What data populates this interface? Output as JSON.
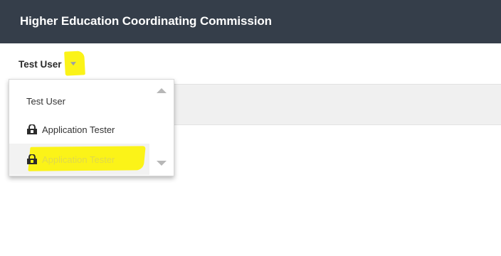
{
  "header": {
    "title": "Higher Education Coordinating Commission"
  },
  "user_menu": {
    "current_user": "Test User",
    "caret_icon": "chevron-down-icon",
    "highlight_color": "#fbf318",
    "items": [
      {
        "label": "Test User",
        "icon": null
      },
      {
        "label": "Application Tester",
        "icon": "lock-badge-icon"
      },
      {
        "label": "Application Tester",
        "icon": "lock-badge-icon",
        "state": "hovered"
      }
    ]
  },
  "scrollbar": {
    "up_icon": "triangle-up-icon",
    "down_icon": "triangle-down-icon"
  },
  "colors": {
    "header_bg": "#353e4a",
    "header_text": "#ffffff",
    "band_bg": "#f0f0f0",
    "hovered_item_bg": "#f2f2f2"
  }
}
